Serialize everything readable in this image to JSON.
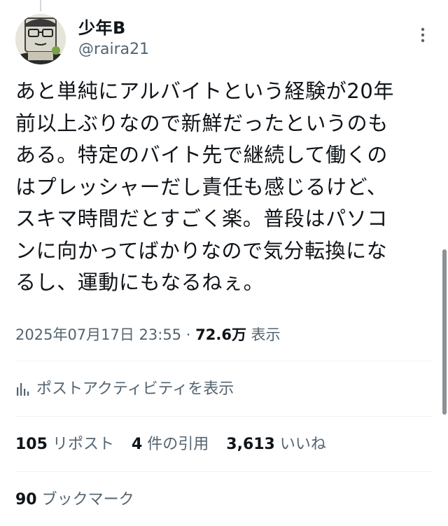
{
  "author": {
    "display_name": "少年B",
    "handle": "@raira21"
  },
  "tweet": {
    "lines": [
      "あと単純にアルバイトという経験が20年",
      "前以上ぶりなので新鮮だったというのも",
      "ある。特定のバイト先で継続して働くの",
      "はプレッシャーだし責任も感じるけど、",
      "スキマ時間だとすごく楽。普段はパソコ",
      "ンに向かってばかりなので気分転換にな",
      "るし、運動にもなるねぇ。"
    ]
  },
  "meta": {
    "timestamp": "2025年07月17日 23:55",
    "separator": "·",
    "views_count": "72.6万",
    "views_label": "表示"
  },
  "activity": {
    "icon": "analytics-icon",
    "label": "ポストアクティビティを表示"
  },
  "stats": {
    "reposts": {
      "count": "105",
      "label": "リポスト"
    },
    "quotes": {
      "count": "4",
      "label": "件の引用"
    },
    "likes": {
      "count": "3,613",
      "label": "いいね"
    },
    "bookmarks": {
      "count": "90",
      "label": "ブックマーク"
    }
  },
  "colors": {
    "text": "#0f1419",
    "secondary": "#536471",
    "divider": "#eff3f4"
  }
}
